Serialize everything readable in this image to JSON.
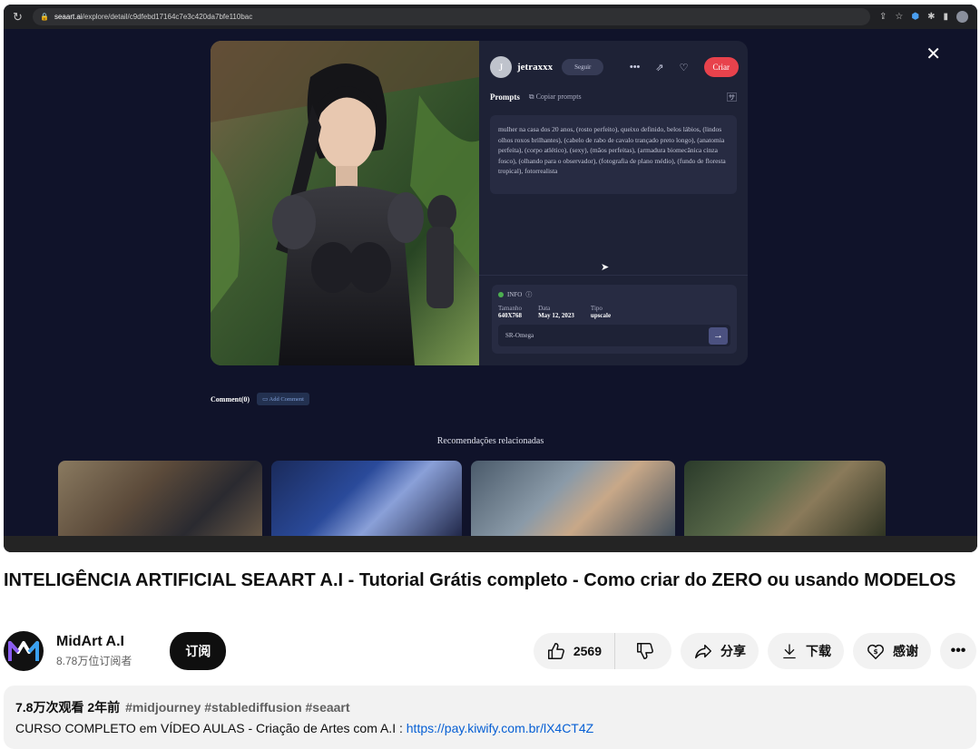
{
  "browser": {
    "url_domain": "seaart.ai",
    "url_path": "/explore/detail/c9dfebd17164c7e3c420da7bfe110bac",
    "reload_icon": "reload-icon",
    "lock_icon": "lock-icon"
  },
  "seaart": {
    "close_icon": "close-icon",
    "avatar_letter": "J",
    "username": "jetraxxx",
    "follow_label": "Seguir",
    "create_label": "Criar",
    "prompts_title": "Prompts",
    "copy_prompts_label": "Copiar prompts",
    "prompt_text": "mulher na casa dos 20 anos, (rosto perfeito), queixo definido, belos lábios, (lindos olhos roxos brilhantes), (cabelo de rabo de cavalo trançado preto longo), (anatomia perfeita), (corpo atlético), (sexy), (mãos perfeitas), (armadura biomecânica cinza fosco), (olhando para o observador), (fotografia de plano médio), (fundo de floresta tropical), fotorrealista",
    "info_label": "INFO",
    "info": [
      {
        "key": "Tamanho",
        "value": "640X768"
      },
      {
        "key": "Data",
        "value": "May 12, 2023"
      },
      {
        "key": "Tipo",
        "value": "upscale"
      }
    ],
    "model_name": "SR-Omega",
    "comment_title": "Comment(0)",
    "add_comment_label": "Add Comment",
    "recommendations_title": "Recomendações relacionadas"
  },
  "video": {
    "title": "INTELIGÊNCIA ARTIFICIAL SEAART A.I - Tutorial Grátis completo - Como criar do ZERO ou usando MODELOS",
    "channel_name": "MidArt A.I",
    "subscribers": "8.78万位订阅者",
    "subscribe_label": "订阅",
    "like_count": "2569",
    "share_label": "分享",
    "download_label": "下载",
    "thanks_label": "感谢",
    "views_time": "7.8万次观看  2年前",
    "tags": "#midjourney #stablediffusion #seaart",
    "desc_text": "CURSO COMPLETO em VÍDEO AULAS - Criação de Artes com A.I : ",
    "desc_link": "https://pay.kiwify.com.br/lX4CT4Z"
  },
  "colors": {
    "accent_red": "#e8424c",
    "page_bg": "#10132a",
    "link_blue": "#065fd4"
  }
}
